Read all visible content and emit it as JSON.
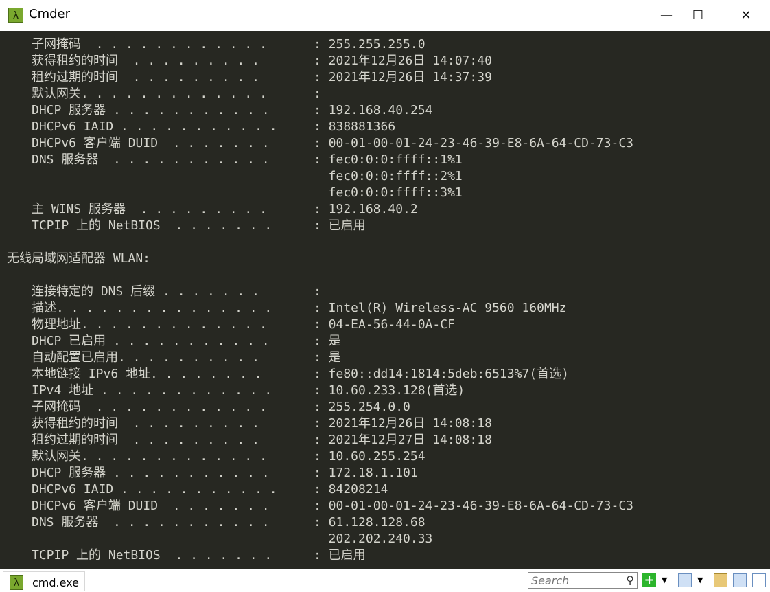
{
  "window": {
    "title": "Cmder",
    "minimize": "—",
    "maximize": "☐",
    "close": "✕"
  },
  "lines": [
    {
      "label": "子网掩码  . . . . . . . . . . . . ",
      "value": ": 255.255.255.0"
    },
    {
      "label": "获得租约的时间  . . . . . . . . . ",
      "value": ": 2021年12月26日 14:07:40"
    },
    {
      "label": "租约过期的时间  . . . . . . . . . ",
      "value": ": 2021年12月26日 14:37:39"
    },
    {
      "label": "默认网关. . . . . . . . . . . . . ",
      "value": ":"
    },
    {
      "label": "DHCP 服务器 . . . . . . . . . . . ",
      "value": ": 192.168.40.254"
    },
    {
      "label": "DHCPv6 IAID . . . . . . . . . . . ",
      "value": ": 838881366"
    },
    {
      "label": "DHCPv6 客户端 DUID  . . . . . . . ",
      "value": ": 00-01-00-01-24-23-46-39-E8-6A-64-CD-73-C3"
    },
    {
      "label": "DNS 服务器  . . . . . . . . . . . ",
      "value": ": fec0:0:0:ffff::1%1"
    },
    {
      "label": "",
      "value": "  fec0:0:0:ffff::2%1"
    },
    {
      "label": "",
      "value": "  fec0:0:0:ffff::3%1"
    },
    {
      "label": "主 WINS 服务器  . . . . . . . . . ",
      "value": ": 192.168.40.2"
    },
    {
      "label": "TCPIP 上的 NetBIOS  . . . . . . . ",
      "value": ": 已启用"
    },
    {
      "header": ""
    },
    {
      "header": "无线局域网适配器 WLAN:"
    },
    {
      "header": ""
    },
    {
      "label": "连接特定的 DNS 后缀 . . . . . . . ",
      "value": ":"
    },
    {
      "label": "描述. . . . . . . . . . . . . . . ",
      "value": ": Intel(R) Wireless-AC 9560 160MHz"
    },
    {
      "label": "物理地址. . . . . . . . . . . . . ",
      "value": ": 04-EA-56-44-0A-CF"
    },
    {
      "label": "DHCP 已启用 . . . . . . . . . . . ",
      "value": ": 是"
    },
    {
      "label": "自动配置已启用. . . . . . . . . . ",
      "value": ": 是"
    },
    {
      "label": "本地链接 IPv6 地址. . . . . . . . ",
      "value": ": fe80::dd14:1814:5deb:6513%7(首选)"
    },
    {
      "label": "IPv4 地址 . . . . . . . . . . . . ",
      "value": ": 10.60.233.128(首选)"
    },
    {
      "label": "子网掩码  . . . . . . . . . . . . ",
      "value": ": 255.254.0.0"
    },
    {
      "label": "获得租约的时间  . . . . . . . . . ",
      "value": ": 2021年12月26日 14:08:18"
    },
    {
      "label": "租约过期的时间  . . . . . . . . . ",
      "value": ": 2021年12月27日 14:08:18"
    },
    {
      "label": "默认网关. . . . . . . . . . . . . ",
      "value": ": 10.60.255.254"
    },
    {
      "label": "DHCP 服务器 . . . . . . . . . . . ",
      "value": ": 172.18.1.101"
    },
    {
      "label": "DHCPv6 IAID . . . . . . . . . . . ",
      "value": ": 84208214"
    },
    {
      "label": "DHCPv6 客户端 DUID  . . . . . . . ",
      "value": ": 00-01-00-01-24-23-46-39-E8-6A-64-CD-73-C3"
    },
    {
      "label": "DNS 服务器  . . . . . . . . . . . ",
      "value": ": 61.128.128.68"
    },
    {
      "label": "",
      "value": "  202.202.240.33"
    },
    {
      "label": "TCPIP 上的 NetBIOS  . . . . . . . ",
      "value": ": 已启用"
    }
  ],
  "statusbar": {
    "tab_label": "cmd.exe",
    "search_placeholder": "Search",
    "app_icon": "λ"
  },
  "colors": {
    "terminal_bg": "#272822",
    "terminal_fg": "#d4d4cc",
    "app_icon": "#7aa82e"
  }
}
